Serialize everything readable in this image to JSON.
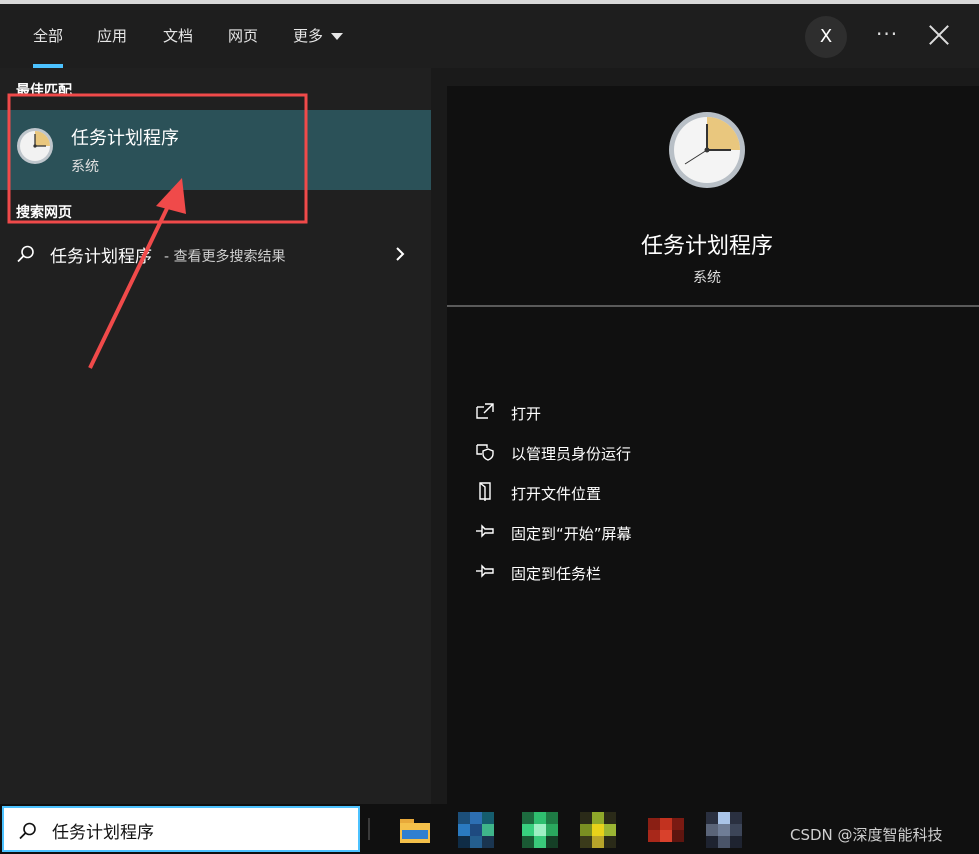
{
  "tabs": [
    "全部",
    "应用",
    "文档",
    "网页",
    "更多"
  ],
  "header": {
    "avatar_letter": "X",
    "more_dots": "···"
  },
  "left": {
    "best_match_label": "最佳匹配",
    "best_match": {
      "title": "任务计划程序",
      "subtitle": "系统"
    },
    "web_label": "搜索网页",
    "web_item": {
      "title": "任务计划程序",
      "subtitle": "- 查看更多搜索结果"
    }
  },
  "detail": {
    "title": "任务计划程序",
    "subtitle": "系统"
  },
  "actions": [
    {
      "label": "打开",
      "icon": "open-icon"
    },
    {
      "label": "以管理员身份运行",
      "icon": "shield-icon"
    },
    {
      "label": "打开文件位置",
      "icon": "file-location-icon"
    },
    {
      "label": "固定到“开始”屏幕",
      "icon": "pin-icon"
    },
    {
      "label": "固定到任务栏",
      "icon": "pin-icon"
    }
  ],
  "taskbar": {
    "search_value": "任务计划程序",
    "watermark": "CSDN @深度智能科技"
  },
  "colors": {
    "accent": "#4cc2ff",
    "selection": "#2b5158",
    "annotation": "#f04a4a"
  }
}
